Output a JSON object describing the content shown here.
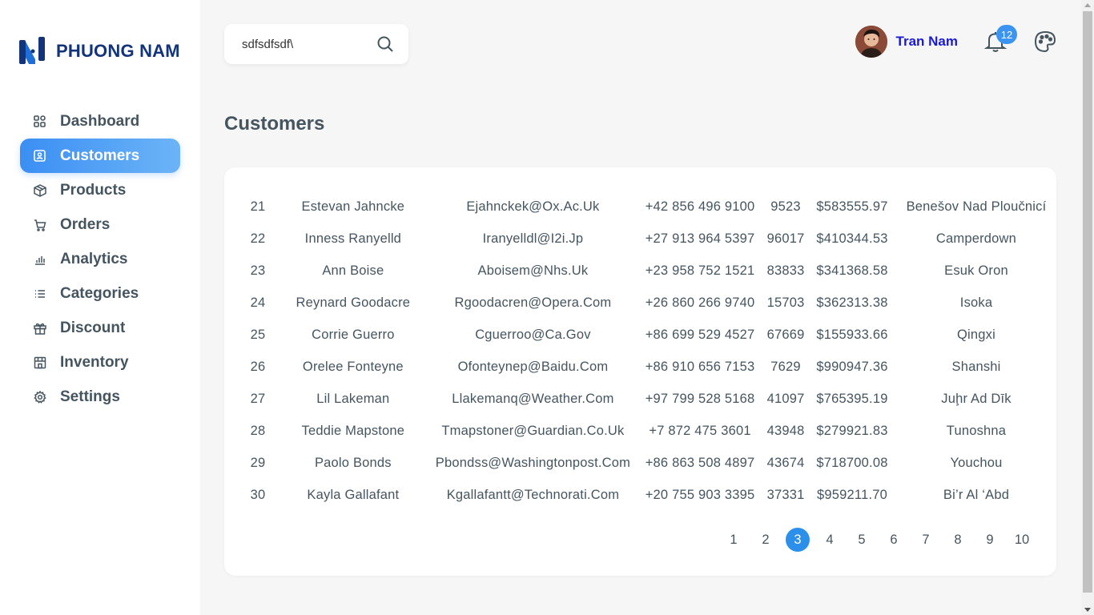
{
  "brand": {
    "name": "PHUONG NAM"
  },
  "sidebar": {
    "items": [
      {
        "label": "Dashboard",
        "icon": "dashboard-icon",
        "active": false
      },
      {
        "label": "Customers",
        "icon": "customers-icon",
        "active": true
      },
      {
        "label": "Products",
        "icon": "box-icon",
        "active": false
      },
      {
        "label": "Orders",
        "icon": "cart-icon",
        "active": false
      },
      {
        "label": "Analytics",
        "icon": "bar-chart-icon",
        "active": false
      },
      {
        "label": "Categories",
        "icon": "list-icon",
        "active": false
      },
      {
        "label": "Discount",
        "icon": "gift-icon",
        "active": false
      },
      {
        "label": "Inventory",
        "icon": "store-icon",
        "active": false
      },
      {
        "label": "Settings",
        "icon": "gear-icon",
        "active": false
      }
    ]
  },
  "search": {
    "value": "sdfsdfsdf\\",
    "placeholder": ""
  },
  "header": {
    "user_name": "Tran Nam",
    "notification_count": "12"
  },
  "page": {
    "title": "Customers"
  },
  "customers": [
    {
      "id": "21",
      "name": "Estevan Jahncke",
      "email": "Ejahnckek@Ox.Ac.Uk",
      "phone": "+42 856 496 9100",
      "zip": "9523",
      "amount": "$583555.97",
      "city": "Benešov Nad Ploučnicí"
    },
    {
      "id": "22",
      "name": "Inness Ranyelld",
      "email": "Iranyelldl@I2i.Jp",
      "phone": "+27 913 964 5397",
      "zip": "96017",
      "amount": "$410344.53",
      "city": "Camperdown"
    },
    {
      "id": "23",
      "name": "Ann Boise",
      "email": "Aboisem@Nhs.Uk",
      "phone": "+23 958 752 1521",
      "zip": "83833",
      "amount": "$341368.58",
      "city": "Esuk Oron"
    },
    {
      "id": "24",
      "name": "Reynard Goodacre",
      "email": "Rgoodacren@Opera.Com",
      "phone": "+26 860 266 9740",
      "zip": "15703",
      "amount": "$362313.38",
      "city": "Isoka"
    },
    {
      "id": "25",
      "name": "Corrie Guerro",
      "email": "Cguerroo@Ca.Gov",
      "phone": "+86 699 529 4527",
      "zip": "67669",
      "amount": "$155933.66",
      "city": "Qingxi"
    },
    {
      "id": "26",
      "name": "Orelee Fonteyne",
      "email": "Ofonteynep@Baidu.Com",
      "phone": "+86 910 656 7153",
      "zip": "7629",
      "amount": "$990947.36",
      "city": "Shanshi"
    },
    {
      "id": "27",
      "name": "Lil Lakeman",
      "email": "Llakemanq@Weather.Com",
      "phone": "+97 799 528 5168",
      "zip": "41097",
      "amount": "$765395.19",
      "city": "Juḩr Ad Dīk"
    },
    {
      "id": "28",
      "name": "Teddie Mapstone",
      "email": "Tmapstoner@Guardian.Co.Uk",
      "phone": "+7 872 475 3601",
      "zip": "43948",
      "amount": "$279921.83",
      "city": "Tunoshna"
    },
    {
      "id": "29",
      "name": "Paolo Bonds",
      "email": "Pbondss@Washingtonpost.Com",
      "phone": "+86 863 508 4897",
      "zip": "43674",
      "amount": "$718700.08",
      "city": "Youchou"
    },
    {
      "id": "30",
      "name": "Kayla Gallafant",
      "email": "Kgallafantt@Technorati.Com",
      "phone": "+20 755 903 3395",
      "zip": "37331",
      "amount": "$959211.70",
      "city": "Bi’r Al ‘Abd"
    }
  ],
  "pagination": {
    "pages": [
      "1",
      "2",
      "3",
      "4",
      "5",
      "6",
      "7",
      "8",
      "9",
      "10"
    ],
    "current": "3"
  },
  "colors": {
    "accent": "#3b8ff3",
    "brand": "#13347a",
    "user_name": "#1a1ad6",
    "text": "#455560"
  }
}
